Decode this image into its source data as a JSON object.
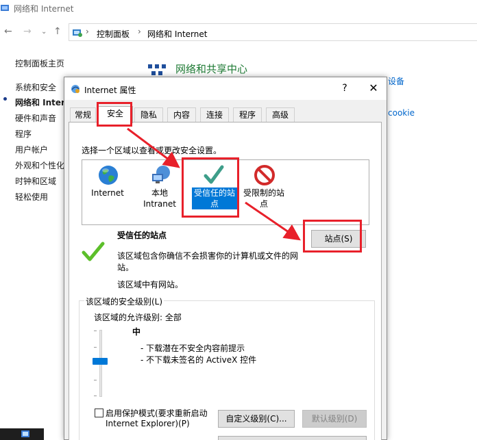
{
  "window": {
    "title": "网络和 Internet"
  },
  "address_bar": {
    "crumbs": [
      "控制面板",
      "网络和 Internet"
    ]
  },
  "sidebar": {
    "items": [
      "控制面板主页",
      "系统和安全",
      "网络和 Interne",
      "硬件和声音",
      "程序",
      "用户帐户",
      "外观和个性化",
      "时钟和区域",
      "轻松使用"
    ]
  },
  "main": {
    "heading": "网络和共享中心",
    "partial_link_1": "设备",
    "partial_link_2": "cookie"
  },
  "dialog": {
    "title": "Internet 属性",
    "help": "?",
    "close": "✕",
    "tabs": [
      "常规",
      "安全",
      "隐私",
      "内容",
      "连接",
      "程序",
      "高级"
    ],
    "selected_tab": "安全",
    "instruction": "选择一个区域以查看或更改安全设置。",
    "zones": [
      {
        "label": "Internet",
        "icon": "globe-icon"
      },
      {
        "label": "本地\nIntranet",
        "icon": "intranet-icon"
      },
      {
        "label": "受信任的站点",
        "icon": "check-icon"
      },
      {
        "label": "受限制的站点",
        "icon": "restricted-icon"
      }
    ],
    "zone_info": {
      "title": "受信任的站点",
      "desc_line1": "该区域包含你确信不会损害你的计算机或文件的网",
      "desc_line2": "站。",
      "has_sites": "该区域中有网站。",
      "sites_button": "站点(S)"
    },
    "security_level": {
      "group_label": "该区域的安全级别(L)",
      "allowed_levels": "该区域的允许级别: 全部",
      "level_name": "中",
      "bullet1": "- 下载潜在不安全内容前提示",
      "bullet2": "- 不下载未签名的 ActiveX 控件"
    },
    "protected_mode": {
      "line1": "启用保护模式(要求重新启动",
      "line2": "Internet Explorer)(P)"
    },
    "custom_level_button": "自定义级别(C)...",
    "default_level_button": "默认级别(D)"
  },
  "colors": {
    "accent": "#0078d7",
    "annotation": "#e8202a",
    "heading_green": "#1e7a34",
    "link_blue": "#0066cc"
  }
}
